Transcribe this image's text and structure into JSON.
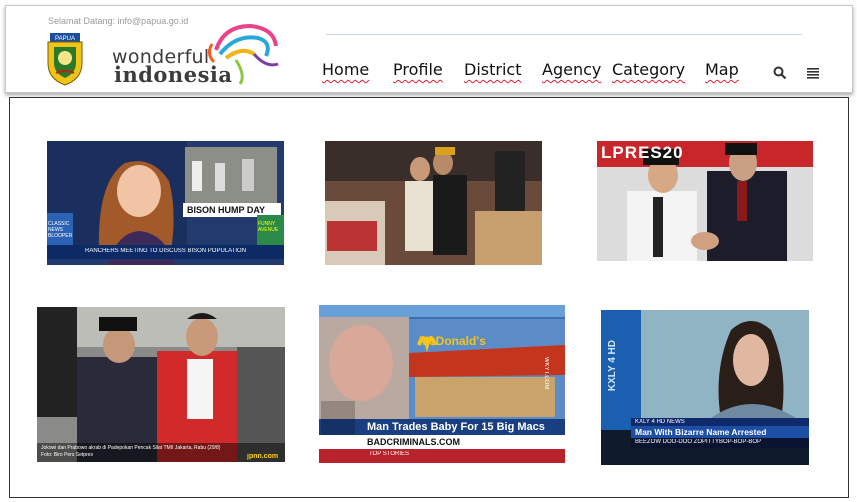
{
  "header": {
    "welcome_text": "Selamat Datang: info@papua.go.id",
    "crest_label": "PAPUA",
    "brand_top": "wonderful",
    "brand_bottom": "indonesia"
  },
  "nav": {
    "items": [
      {
        "label": "Home"
      },
      {
        "label": "Profile"
      },
      {
        "label": "District"
      },
      {
        "label": "Agency"
      },
      {
        "label": "Category"
      },
      {
        "label": "Map"
      }
    ],
    "search_icon": "search-icon",
    "menu_icon": "menu-list-icon"
  },
  "gallery": {
    "tiles": [
      {
        "lower_third": "BISON HUMP DAY",
        "ticker": "RANCHERS MEETING TO DISCUSS BISON POPULATION",
        "bug_left": "CLASSIC NEWS BLOOPERS",
        "bug_right": "FUNNY AVENUE"
      },
      {
        "description_hidden": ""
      },
      {
        "banner": "LPRES20"
      },
      {
        "caption_line1": "Jokowi dan Prabowo akrab di Padepokan Pencak Silat TMII Jakarta, Rabu (29/8)",
        "caption_line2": "Foto: Biro Pers Setpres",
        "watermark": "jpnn.com"
      },
      {
        "headline": "Man Trades Baby For 15 Big Macs",
        "source": "BADCRIMINALS.COM",
        "sign": "McDonald's",
        "ticker": "TOP STORIES",
        "channel": "ACTION NEWS",
        "site_vertical": "WKYT.COM"
      },
      {
        "station": "KXLY 4 HD NEWS",
        "headline": "Man With Bizarre Name Arrested",
        "subline": "BEEZOW DOO-DOO ZOPITTYBOP-BOP-BOP",
        "bug": "KXLY 4 HD"
      }
    ]
  },
  "colors": {
    "nav_underline": "#dd2222",
    "border": "#333333",
    "news_blue": "#1b4f9c"
  }
}
